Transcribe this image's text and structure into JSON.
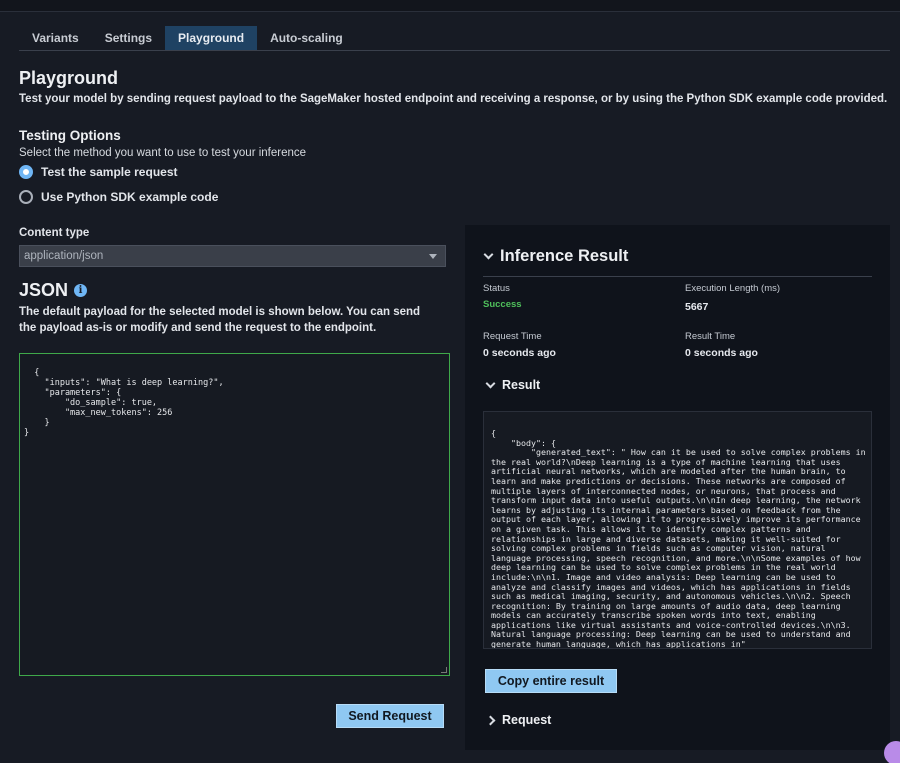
{
  "tabs": [
    {
      "label": "Variants",
      "active": false
    },
    {
      "label": "Settings",
      "active": false
    },
    {
      "label": "Playground",
      "active": true
    },
    {
      "label": "Auto-scaling",
      "active": false
    }
  ],
  "playground": {
    "title": "Playground",
    "description": "Test your model by sending request payload to the SageMaker hosted endpoint and receiving a response, or by using the Python SDK example code provided."
  },
  "testing_options": {
    "title": "Testing Options",
    "subtitle": "Select the method you want to use to test your inference",
    "options": [
      {
        "label": "Test the sample request",
        "checked": true
      },
      {
        "label": "Use Python SDK example code",
        "checked": false
      }
    ]
  },
  "content_type": {
    "label": "Content type",
    "value": "application/json"
  },
  "json_section": {
    "title": "JSON",
    "info_icon": "info-icon",
    "description": "The default payload for the selected model is shown below. You can send the payload as-is or modify and send the request to the endpoint.",
    "payload": "{\n    \"inputs\": \"What is deep learning?\",\n    \"parameters\": {\n        \"do_sample\": true,\n        \"max_new_tokens\": 256\n    }\n}"
  },
  "send_button": "Send Request",
  "inference": {
    "title": "Inference Result",
    "status_label": "Status",
    "status_value": "Success",
    "exec_label": "Execution Length (ms)",
    "exec_value": "5667",
    "request_time_label": "Request Time",
    "request_time_value": "0 seconds ago",
    "result_time_label": "Result Time",
    "result_time_value": "0 seconds ago",
    "result_section": "Result",
    "result_body": "{\n    \"body\": {\n        \"generated_text\": \" How can it be used to solve complex problems in the real world?\\nDeep learning is a type of machine learning that uses artificial neural networks, which are modeled after the human brain, to learn and make predictions or decisions. These networks are composed of multiple layers of interconnected nodes, or neurons, that process and transform input data into useful outputs.\\n\\nIn deep learning, the network learns by adjusting its internal parameters based on feedback from the output of each layer, allowing it to progressively improve its performance on a given task. This allows it to identify complex patterns and relationships in large and diverse datasets, making it well-suited for solving complex problems in fields such as computer vision, natural language processing, speech recognition, and more.\\n\\nSome examples of how deep learning can be used to solve complex problems in the real world include:\\n\\n1. Image and video analysis: Deep learning can be used to analyze and classify images and videos, which has applications in fields such as medical imaging, security, and autonomous vehicles.\\n\\n2. Speech recognition: By training on large amounts of audio data, deep learning models can accurately transcribe spoken words into text, enabling applications like virtual assistants and voice-controlled devices.\\n\\n3. Natural language processing: Deep learning can be used to understand and generate human language, which has applications in\"\n    },",
    "copy_button": "Copy entire result",
    "request_section": "Request"
  }
}
